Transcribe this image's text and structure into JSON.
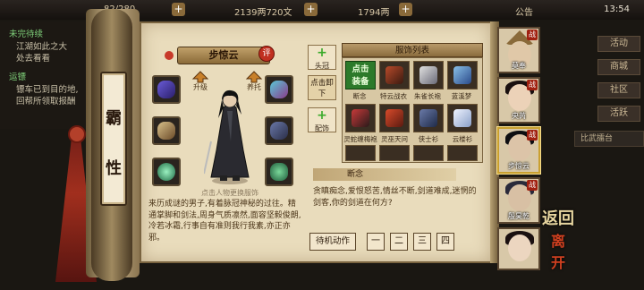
{
  "hud": {
    "stamina": "82/280",
    "currency": "2139两720文",
    "ingot": "1794两",
    "notice": "公告",
    "clock": "13:54"
  },
  "quests": {
    "header1": "未完待续",
    "line1": "江湖如此之大",
    "line2": "处去看看",
    "header2": "运镖",
    "line3": "镖车已到目的地,",
    "line4": "回帮所领取报酬"
  },
  "right_menu": [
    "活动",
    "商城",
    "社区",
    "活跃"
  ],
  "right_bar": "比武擂台",
  "clan": {
    "chars": [
      "霸",
      "性"
    ]
  },
  "character": {
    "name": "步惊云",
    "rate_badge": "评",
    "hint": "点击人物更换服饰",
    "actions": {
      "left": "升级",
      "right": "养托"
    },
    "desc_parts": [
      {
        "t": "来历成谜的男子,有着脉冠神秘的过往。精通掌脚和剑法,周身气质凛然,面容坚毅俊朗,冷若冰霜,行事自有准则",
        "c": false
      },
      {
        "t": "我行我素,亦正亦邪。",
        "c": false
      }
    ]
  },
  "side_buttons": {
    "headwear": "头冠",
    "unequip": "点击卸下",
    "accessory": "配饰"
  },
  "outfits": {
    "title": "服饰列表",
    "equip_label_1": "点击",
    "equip_label_2": "装备",
    "row1": [
      "断念",
      "特云战衣",
      "朱雀长袍",
      "蓝溪梦"
    ],
    "row2": [
      "灵蛇缠梅袍",
      "灵巫天问",
      "侠士衫",
      "云楼衫"
    ]
  },
  "duannian": {
    "title": "断念",
    "text": "贪瞋痴念,爱恨怒苦,情丝不断,剑道难成,迷惘的剑客,你的剑道在何方?"
  },
  "idle": {
    "label": "待机动作",
    "nums": [
      "一",
      "二",
      "三",
      "四"
    ]
  },
  "roster": [
    {
      "name": "莫奉"
    },
    {
      "name": "央芮"
    },
    {
      "name": "步惊云"
    },
    {
      "name": "殷昊乾"
    },
    {
      "name": ""
    }
  ],
  "return_btn": {
    "top": "返回",
    "bottom": "离开"
  },
  "colors": {
    "paper": "#e9dcbc",
    "accent_red": "#c03020",
    "equip_green": "#2c7a2a",
    "plus_green": "#3aaa2a"
  }
}
